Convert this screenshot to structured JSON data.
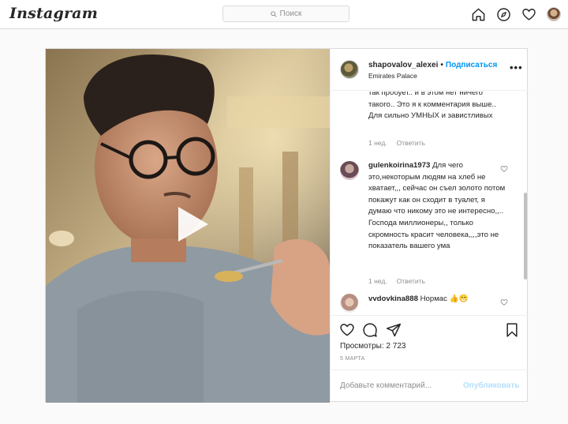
{
  "header": {
    "logo": "Instagram",
    "search_placeholder": "Поиск"
  },
  "post": {
    "username": "shapovalov_alexei",
    "separator": "•",
    "follow_label": "Подписаться",
    "location": "Emirates Palace",
    "more_label": "•••",
    "views": "Просмотры: 2 723",
    "date": "5 МАРТА",
    "comment_placeholder": "Добавьте комментарий...",
    "publish_label": "Опубликовать"
  },
  "comments": [
    {
      "username": "",
      "text": "так пробует.. и в этом нет ничего такого.. Это я к комментария выше.. Для сильно УМНЫХ и завистливых",
      "time": "1 нед.",
      "reply": "Ответить"
    },
    {
      "username": "gulenkoirina1973",
      "text": "Для чего это,некоторым людям на хлеб не хватает,,, сейчас он съел золото потом покажут как он сходит в туалет, я думаю что никому это не интересно,,.. Господа миллионеры,, только скромность красит человека,,,,это не показатель вашего ума",
      "time": "1 нед.",
      "reply": "Ответить"
    },
    {
      "username": "vvdovkina888",
      "text": "Нормас 👍😁",
      "time": "",
      "reply": ""
    }
  ],
  "icons": {
    "home": "home-icon",
    "explore": "compass-icon",
    "activity": "heart-icon",
    "search": "search-icon",
    "play": "play-icon",
    "like": "heart-icon",
    "comment": "comment-icon",
    "share": "send-icon",
    "save": "bookmark-icon"
  },
  "colors": {
    "accent": "#0095f6",
    "publish_disabled": "#b2dffc",
    "muted": "#8e8e8e"
  }
}
